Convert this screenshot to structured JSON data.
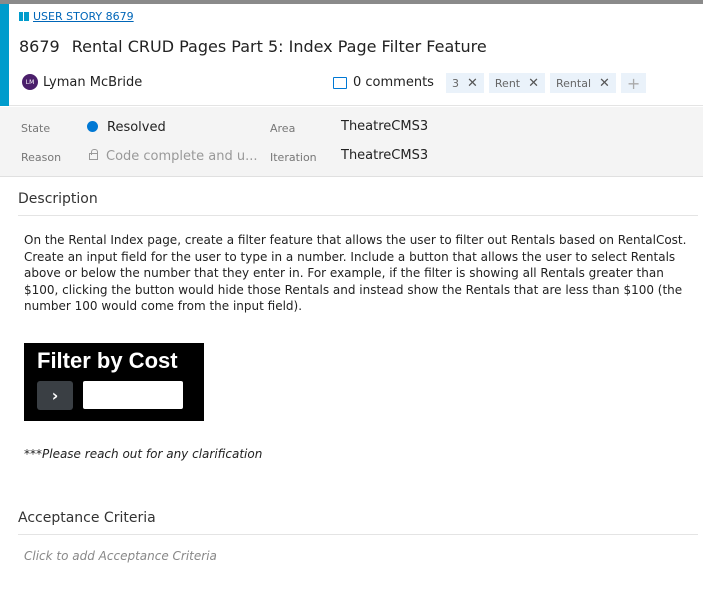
{
  "breadcrumb": "USER STORY 8679",
  "work_item": {
    "id": "8679",
    "title": "Rental CRUD Pages Part 5: Index Page Filter Feature"
  },
  "author": {
    "initials": "LM",
    "name": "Lyman McBride"
  },
  "comments": "0 comments",
  "tags": [
    "3",
    "Rent",
    "Rental"
  ],
  "tag_add": "+",
  "tag_remove": "✕",
  "fields": {
    "state_label": "State",
    "state_value": "Resolved",
    "reason_label": "Reason",
    "reason_value": "Code complete and u...",
    "area_label": "Area",
    "area_value": "TheatreCMS3",
    "iteration_label": "Iteration",
    "iteration_value": "TheatreCMS3"
  },
  "colors": {
    "accent": "#009ccc",
    "state": "#0078d4"
  },
  "description": {
    "heading": "Description",
    "body": "On the Rental Index page, create a filter feature that allows the user to filter out Rentals based on RentalCost.  Create an input field for the user to type in a number.  Include a button that allows the user to select Rentals above or below the number that they enter in.  For example, if the filter is showing all Rentals greater than $100, clicking the button would hide those Rentals and instead show the Rentals that are less than $100 (the number 100 would come from the input field).",
    "image_title": "Filter by Cost",
    "image_button": "›",
    "note": "***Please reach out for any clarification"
  },
  "acceptance": {
    "heading": "Acceptance Criteria",
    "placeholder": "Click to add Acceptance Criteria"
  }
}
